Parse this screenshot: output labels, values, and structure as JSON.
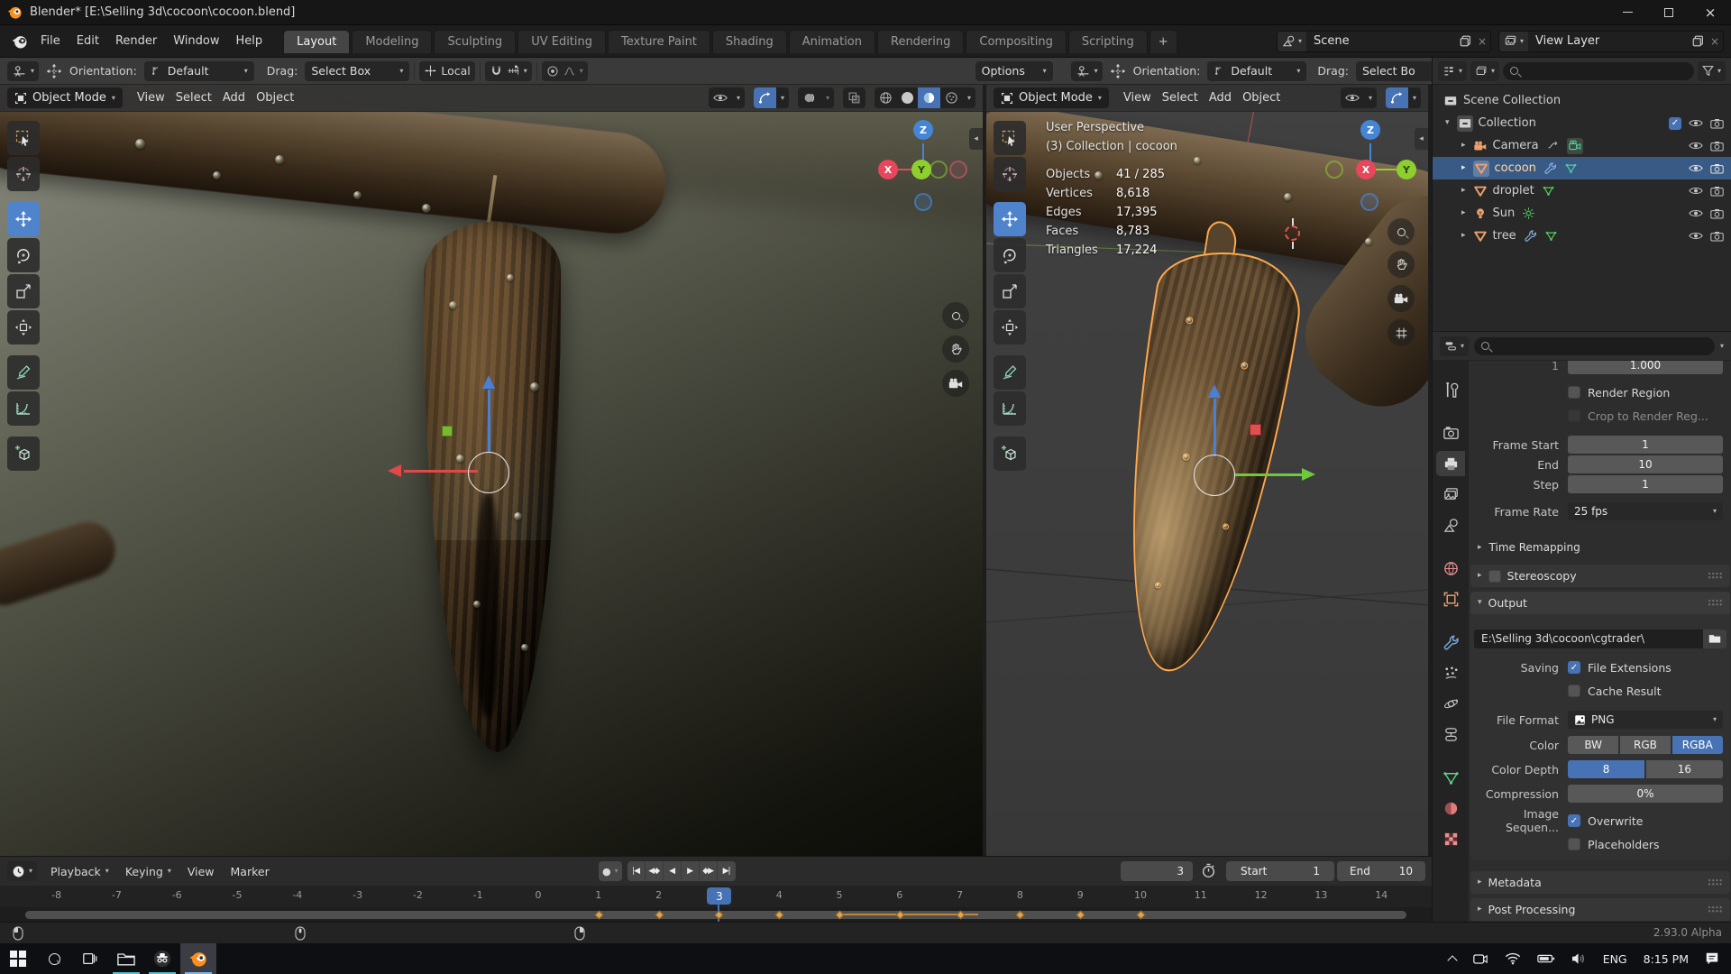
{
  "window": {
    "title": "Blender* [E:\\Selling 3d\\cocoon\\cocoon.blend]",
    "version": "2.93.0 Alpha"
  },
  "icons": {
    "dropdown": "▾",
    "tri_right": "▸",
    "tri_down": "▾",
    "close": "×",
    "check": "✓",
    "transport": [
      "|◀",
      "◀◆",
      "◀",
      "▶",
      "◆▶",
      "▶|"
    ],
    "record": "●",
    "plus": "+",
    "collapse_left": "◂"
  },
  "topbar": {
    "menus": [
      "File",
      "Edit",
      "Render",
      "Window",
      "Help"
    ],
    "tabs": [
      "Layout",
      "Modeling",
      "Sculpting",
      "UV Editing",
      "Texture Paint",
      "Shading",
      "Animation",
      "Rendering",
      "Compositing",
      "Scripting"
    ],
    "active_tab": "Layout",
    "add_tab": "+",
    "scene_label": "Scene",
    "view_layer_label": "View Layer"
  },
  "tool_settings": {
    "orientation_label": "Orientation:",
    "orientation_value": "Default",
    "drag_label": "Drag:",
    "drag_value": "Select Box",
    "drag_value_right": "Select Bo",
    "pivot_value": "Local",
    "options_label": "Options"
  },
  "viewport_tools": {
    "list": [
      "select-box",
      "cursor",
      "move",
      "rotate",
      "scale",
      "transform",
      "annotate",
      "measure",
      "add-cube"
    ],
    "active": "move"
  },
  "viewport1": {
    "mode": "Object Mode",
    "menus": [
      "View",
      "Select",
      "Add",
      "Object"
    ]
  },
  "viewport2": {
    "mode": "Object Mode",
    "menus": [
      "View",
      "Select",
      "Add",
      "Object"
    ],
    "overlay": {
      "view": "User Perspective",
      "context": "(3) Collection | cocoon",
      "stats": [
        {
          "label": "Objects",
          "value": "41 / 285"
        },
        {
          "label": "Vertices",
          "value": "8,618"
        },
        {
          "label": "Edges",
          "value": "17,395"
        },
        {
          "label": "Faces",
          "value": "8,783"
        },
        {
          "label": "Triangles",
          "value": "17,224"
        }
      ]
    }
  },
  "axis": {
    "x": "X",
    "y": "Y",
    "z": "Z"
  },
  "outliner": {
    "root": "Scene Collection",
    "collection": "Collection",
    "items": [
      {
        "name": "Camera"
      },
      {
        "name": "cocoon"
      },
      {
        "name": "droplet"
      },
      {
        "name": "Sun"
      },
      {
        "name": "tree"
      }
    ],
    "selected": "cocoon"
  },
  "properties_tabs": {
    "list": [
      "tool",
      "render",
      "output",
      "view-layer",
      "scene",
      "world",
      "object",
      "modifiers",
      "particles",
      "physics",
      "constraints",
      "data",
      "material",
      "texture"
    ],
    "active": "output"
  },
  "properties": {
    "top_tick": "1",
    "top_value": "1.000",
    "render_region": "Render Region",
    "crop_to_render": "Crop to Render Reg...",
    "frame_start_label": "Frame Start",
    "frame_start": "1",
    "end_label": "End",
    "end": "10",
    "step_label": "Step",
    "step": "1",
    "frame_rate_label": "Frame Rate",
    "frame_rate": "25 fps",
    "time_remapping": "Time Remapping",
    "stereoscopy": "Stereoscopy",
    "output": "Output",
    "output_path": "E:\\Selling 3d\\cocoon\\cgtrader\\",
    "saving_label": "Saving",
    "file_extensions": "File Extensions",
    "cache_result": "Cache Result",
    "file_format_label": "File Format",
    "file_format": "PNG",
    "color_label": "Color",
    "color_options": [
      "BW",
      "RGB",
      "RGBA"
    ],
    "color_selected": "RGBA",
    "color_depth_label": "Color Depth",
    "depth_options": [
      "8",
      "16"
    ],
    "depth_selected": "8",
    "compression_label": "Compression",
    "compression": "0%",
    "image_sequence_label": "Image Sequen...",
    "overwrite": "Overwrite",
    "placeholders": "Placeholders",
    "metadata": "Metadata",
    "post_processing": "Post Processing"
  },
  "timeline": {
    "menus": [
      "Playback",
      "Keying",
      "View",
      "Marker"
    ],
    "ticks": [
      -8,
      -7,
      -6,
      -5,
      -4,
      -3,
      -2,
      -1,
      0,
      1,
      2,
      4,
      5,
      6,
      7,
      8,
      9,
      10,
      11,
      12,
      13,
      14
    ],
    "current": 3,
    "current_label": "3",
    "start_label": "Start",
    "start": "1",
    "end_label": "End",
    "end": "10",
    "keyframes": [
      1,
      2,
      3,
      4,
      5,
      6,
      7,
      8,
      9,
      10
    ]
  },
  "statusbar": {
    "version": "2.93.0 Alpha"
  },
  "taskbar": {
    "lang": "ENG",
    "time": "8:15 PM"
  },
  "colors": {
    "accent": "#4772b3",
    "selection": "#3a5a86",
    "keyframe": "#e0a452",
    "blender_orange": "#ff8d1c",
    "active_outline": "#ffa94d"
  }
}
